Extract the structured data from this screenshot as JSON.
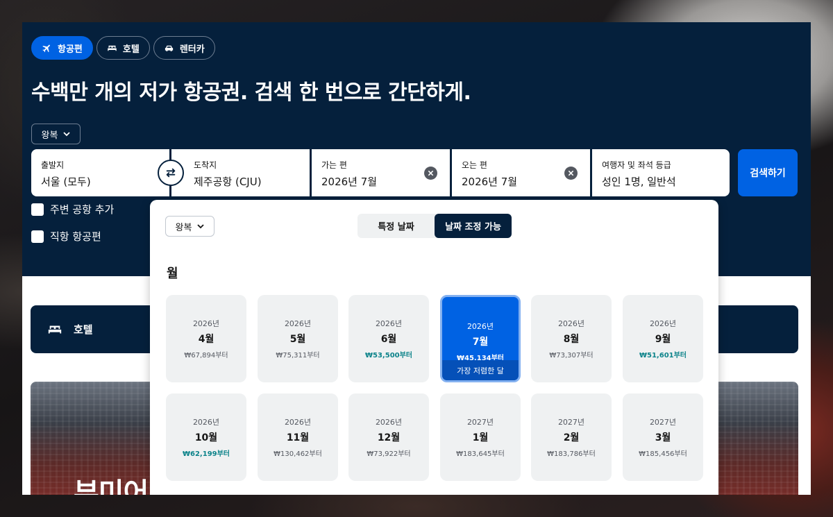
{
  "tabs": [
    {
      "label": "항공편",
      "icon": "plane-icon",
      "active": true
    },
    {
      "label": "호텔",
      "icon": "bed-icon",
      "active": false
    },
    {
      "label": "렌터카",
      "icon": "car-icon",
      "active": false
    }
  ],
  "headline": "수백만 개의 저가 항공권. 검색 한 번으로 간단하게.",
  "trip_type": "왕복",
  "search": {
    "origin_label": "출발지",
    "origin_value": "서울 (모두)",
    "destination_label": "도착지",
    "destination_value": "제주공항 (CJU)",
    "depart_label": "가는 편",
    "depart_value": "2026년 7월",
    "return_label": "오는 편",
    "return_value": "2026년 7월",
    "travellers_label": "여행자 및 좌석 등급",
    "travellers_value": "성인 1명, 일반석",
    "button": "검색하기"
  },
  "options": {
    "nearby_airports": "주변 공항 추가",
    "direct_flights": "직항 항공편"
  },
  "hotel_card": {
    "label": "호텔"
  },
  "promo": {
    "text": "부미어"
  },
  "popup": {
    "trip_type": "왕복",
    "toggle": {
      "specific": "특정 날짜",
      "flexible": "날짜 조정 가능",
      "selected": "flexible"
    },
    "heading": "월",
    "cheapest_label": "가장 저렴한 달",
    "months": [
      {
        "year": "2026년",
        "month": "4월",
        "price": "₩67,894부터",
        "low": false,
        "selected": false
      },
      {
        "year": "2026년",
        "month": "5월",
        "price": "₩75,311부터",
        "low": false,
        "selected": false
      },
      {
        "year": "2026년",
        "month": "6월",
        "price": "₩53,500부터",
        "low": true,
        "selected": false
      },
      {
        "year": "2026년",
        "month": "7월",
        "price": "₩45,134부터",
        "low": true,
        "selected": true
      },
      {
        "year": "2026년",
        "month": "8월",
        "price": "₩73,307부터",
        "low": false,
        "selected": false
      },
      {
        "year": "2026년",
        "month": "9월",
        "price": "₩51,601부터",
        "low": true,
        "selected": false
      },
      {
        "year": "2026년",
        "month": "10월",
        "price": "₩62,199부터",
        "low": true,
        "selected": false
      },
      {
        "year": "2026년",
        "month": "11월",
        "price": "₩130,462부터",
        "low": false,
        "selected": false
      },
      {
        "year": "2026년",
        "month": "12월",
        "price": "₩73,922부터",
        "low": false,
        "selected": false
      },
      {
        "year": "2027년",
        "month": "1월",
        "price": "₩183,645부터",
        "low": false,
        "selected": false
      },
      {
        "year": "2027년",
        "month": "2월",
        "price": "₩183,786부터",
        "low": false,
        "selected": false
      },
      {
        "year": "2027년",
        "month": "3월",
        "price": "₩185,456부터",
        "low": false,
        "selected": false
      }
    ]
  },
  "colors": {
    "hero_bg": "#05203c",
    "primary": "#0062e3",
    "low_price": "#0c838a"
  }
}
